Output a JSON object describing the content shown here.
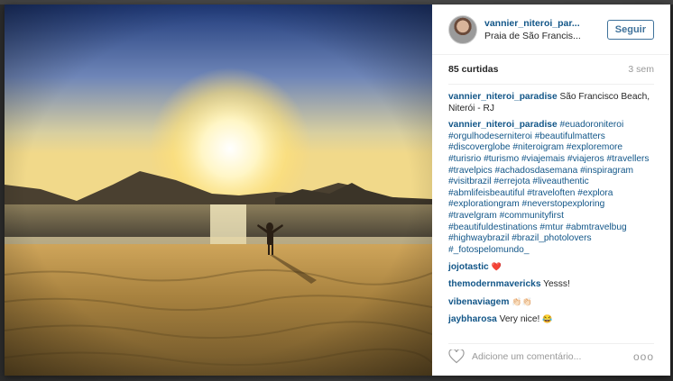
{
  "post": {
    "username": "vannier_niteroi_par...",
    "location": "Praia de São Francis...",
    "follow_label": "Seguir",
    "likes": "85 curtidas",
    "time_ago": "3 sem"
  },
  "caption": {
    "username": "vannier_niteroi_paradise",
    "text": " São Francisco Beach, Niterói - RJ"
  },
  "hashtag_comment": {
    "username": "vannier_niteroi_paradise",
    "tags": " #euadoroniteroi #orgulhodeserniteroi #beautifulmatters #discoverglobe #niteroigram #exploremore #turisrio #turismo #viajemais #viajeros #travellers #travelpics #achadosdasemana #inspiragram #visitbrazil #errejota #liveauthentic #abmlifeisbeautiful #traveloften #explora #explorationgram #neverstopexploring #travelgram #communityfirst #beautifuldestinations #mtur #abmtravelbug #highwaybrazil #brazil_photolovers #_fotospelomundo_"
  },
  "comments": [
    {
      "username": "jojotastic",
      "text": " ",
      "emoji": "❤️"
    },
    {
      "username": "themodernmavericks",
      "text": " Yesss!",
      "emoji": ""
    },
    {
      "username": "vibenaviagem",
      "text": " ",
      "emoji": "👏🏻👏🏻"
    },
    {
      "username": "jaybharosa",
      "text": " Very nice! ",
      "emoji": "😂"
    }
  ],
  "footer": {
    "comment_placeholder": "Adicione um comentário...",
    "more_label": "ooo"
  },
  "icons": {
    "heart": "heart-icon",
    "more": "more-options-icon"
  },
  "colors": {
    "link_blue": "#125688",
    "follow_blue": "#3f729b",
    "muted": "#999999"
  }
}
